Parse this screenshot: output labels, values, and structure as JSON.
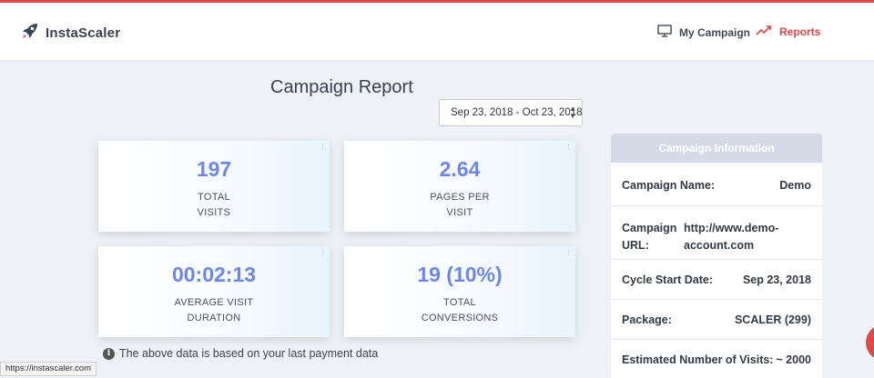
{
  "colors": {
    "accent": "#e04848",
    "stat_number": "#6c86ec",
    "panel_header": "#d5dbe6"
  },
  "brand": {
    "name": "InstaScaler",
    "icon": "rocket-icon"
  },
  "nav": {
    "my_campaign": {
      "label": "My Campaign",
      "icon": "monitor-icon"
    },
    "reports": {
      "label": "Reports",
      "icon": "trending-up-icon"
    }
  },
  "page": {
    "title": "Campaign Report"
  },
  "date_range": {
    "value": "Sep 23, 2018 - Oct 23, 2018"
  },
  "stats": [
    {
      "value": "197",
      "label": "TOTAL\nVISITS"
    },
    {
      "value": "2.64",
      "label": "PAGES PER\nVISIT"
    },
    {
      "value": "00:02:13",
      "label": "AVERAGE VISIT\nDURATION"
    },
    {
      "value": "19 (10%)",
      "label": "TOTAL\nCONVERSIONS"
    }
  ],
  "note": {
    "text": "The above data is based on your last payment data",
    "icon": "info-icon"
  },
  "campaign_info": {
    "title": "Campaign Information",
    "rows": [
      {
        "key": "Campaign Name:",
        "value": "Demo"
      },
      {
        "key": "Campaign URL:",
        "value": "http://www.demo-account.com"
      },
      {
        "key": "Cycle Start Date:",
        "value": "Sep 23, 2018"
      },
      {
        "key": "Package:",
        "value": "SCALER (299)"
      },
      {
        "key": "Estimated Number of Visits:",
        "value": "~ 2000"
      }
    ]
  },
  "status_bar": {
    "url": "https://instascaler.com"
  }
}
